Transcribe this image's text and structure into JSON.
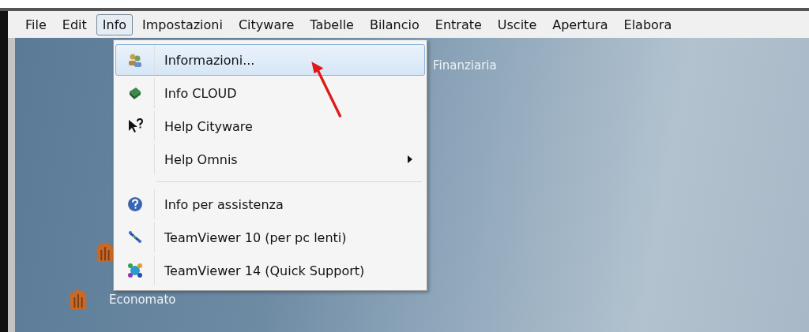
{
  "menu_bar": [
    {
      "label": "File",
      "selected": false
    },
    {
      "label": "Edit",
      "selected": false
    },
    {
      "label": "Info",
      "selected": true
    },
    {
      "label": "Impostazioni",
      "selected": false
    },
    {
      "label": "Cityware",
      "selected": false
    },
    {
      "label": "Tabelle",
      "selected": false
    },
    {
      "label": "Bilancio",
      "selected": false
    },
    {
      "label": "Entrate",
      "selected": false
    },
    {
      "label": "Uscite",
      "selected": false
    },
    {
      "label": "Apertura",
      "selected": false
    },
    {
      "label": "Elabora",
      "selected": false
    }
  ],
  "dropdown": [
    {
      "kind": "item",
      "label": "Informazioni...",
      "selected": true,
      "submenu": false
    },
    {
      "kind": "item",
      "label": "Info CLOUD",
      "selected": false,
      "submenu": false
    },
    {
      "kind": "item",
      "label": "Help Cityware",
      "selected": false,
      "submenu": false
    },
    {
      "kind": "item",
      "label": "Help Omnis",
      "selected": false,
      "submenu": true
    },
    {
      "kind": "separator"
    },
    {
      "kind": "item",
      "label": "Info per assistenza",
      "selected": false,
      "submenu": false
    },
    {
      "kind": "item",
      "label": "TeamViewer 10 (per pc lenti)",
      "selected": false,
      "submenu": false
    },
    {
      "kind": "item",
      "label": "TeamViewer 14 (Quick Support)",
      "selected": false,
      "submenu": false
    }
  ],
  "desktop": [
    {
      "label": "Finanziaria"
    },
    {
      "label": "Economato"
    }
  ]
}
